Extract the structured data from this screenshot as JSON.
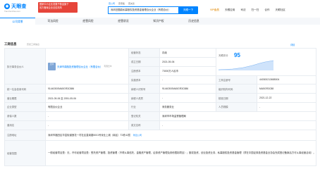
{
  "header": {
    "logo_text": "天眼查",
    "logo_sub": "TianYanCha.com",
    "promo_line1": "国家中小企业发展子基金旗下",
    "promo_line2": "官方备案企业征信机构",
    "search_tabs": [
      "查公司",
      "查老板",
      "查关系"
    ],
    "search_value": "深圳旧题鼎私募股权投资基金管理合伙企业（有限合伙）",
    "search_button": "天眼一下",
    "nav": [
      "VIP会员",
      "天眼应用",
      "司法",
      "扫一扫",
      "合作",
      "天眼社区"
    ]
  },
  "tabs": [
    "公司背景",
    "司法风险",
    "经营风险",
    "经营状况",
    "知识产权",
    "历史信息"
  ],
  "section": {
    "title": "工商信息",
    "tip": "历史工商信息",
    "right_link": "详情"
  },
  "business_info": {
    "rep_label": "执行事务合伙人",
    "rep_avatar_text": "天津",
    "rep_name": "天津市鼎融投资管理合伙企业（有限合伙）",
    "rep_tag": "有限合伙",
    "status_label": "经营状态",
    "status_value": "存续",
    "est_date_label": "成立日期",
    "est_date_value": "2021-05-06",
    "capital_label": "注册资本",
    "capital_value": "73000万人民币",
    "paidin_label": "实缴资本",
    "paidin_value": "-",
    "score_label": "天眼评分",
    "score_value": "95",
    "reg_no_label": "工商注册号",
    "reg_no_value": "440300213685004",
    "credit_code_label": "统一社会信用代码",
    "credit_code_value": "91440300MA5GR3C886",
    "taxpayer_label": "纳税人识别号",
    "taxpayer_value": "91440300MA5GR3C886",
    "org_code_label": "组织机构代码",
    "org_code_value": "MA5GR3C88",
    "term_label": "营业期限",
    "term_value": "2021-05-06 至 2051-05-06",
    "qual_label": "纳税人资质",
    "qual_value": "-",
    "approve_label": "核准日期",
    "approve_value": "2021-12-22",
    "type_label": "企业类型",
    "type_value": "有限合伙企业",
    "industry_label": "行业",
    "industry_value": "商务服务业",
    "staff_label": "人员规模",
    "staff_value": "-",
    "insured_label": "参保人数",
    "insured_value": "-",
    "authority_label": "登记机关",
    "authority_value": "深圳市市场监督管理局",
    "former_label": "曾用名",
    "former_value": "-",
    "english_label": "英文名称",
    "english_value": "-",
    "address_label": "注册地址",
    "address_value": "深圳市福田区华富街道莲花一村社区皇岗路5001号深业上城（南区）T2栋42层",
    "address_link": "附近公司",
    "scope_label": "经营范围",
    "scope_value": "一般经营项目是：无，许可经营项目是：受托资产管理、投资管理（不得从事信托、金融资产管理、证券资产管理及其他限制项目）；股权投资、创业投资业务、私募股权投资基金管理（须在中国证券投资基金业协会完成登记备案后方可从事经营活动）。"
  },
  "colors": {
    "brand": "#0084ff",
    "promo": "#e6453a",
    "label_bg": "#f5f8fb"
  }
}
